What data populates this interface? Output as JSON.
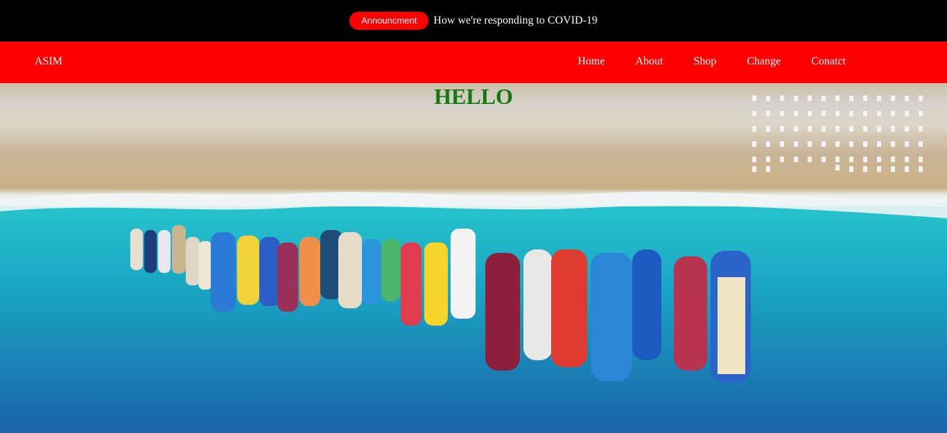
{
  "announcement": {
    "badge": "Announcment",
    "text": "How we're responding to COVID-19"
  },
  "navbar": {
    "brand": "ASIM",
    "links": [
      "Home",
      "About",
      "Shop",
      "Change",
      "Conatct"
    ]
  },
  "hero": {
    "title": "HELLO",
    "image_subject": "aerial view of boats moored along a beach"
  },
  "colors": {
    "nav_bg": "#ff0000",
    "top_bar_bg": "#000000",
    "badge_bg": "#ff0000",
    "hero_title": "#107a10"
  }
}
